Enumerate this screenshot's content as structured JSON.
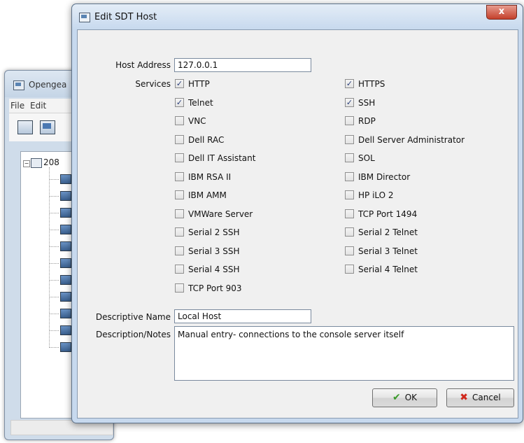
{
  "background_window": {
    "title": "Opengea",
    "menu": [
      "File",
      "Edit"
    ],
    "tree_root_label": "208",
    "tree_root_toggle": "−"
  },
  "dialog": {
    "title": "Edit SDT Host",
    "close_symbol": "x",
    "host_address_label": "Host Address",
    "host_address_value": "127.0.0.1",
    "services_label": "Services",
    "services_left": [
      {
        "label": "HTTP",
        "checked": true
      },
      {
        "label": "Telnet",
        "checked": true
      },
      {
        "label": "VNC",
        "checked": false
      },
      {
        "label": "Dell RAC",
        "checked": false
      },
      {
        "label": "Dell IT Assistant",
        "checked": false
      },
      {
        "label": "IBM RSA II",
        "checked": false
      },
      {
        "label": "IBM AMM",
        "checked": false
      },
      {
        "label": "VMWare Server",
        "checked": false
      },
      {
        "label": "Serial 2 SSH",
        "checked": false
      },
      {
        "label": "Serial 3 SSH",
        "checked": false
      },
      {
        "label": "Serial 4 SSH",
        "checked": false
      },
      {
        "label": "TCP Port 903",
        "checked": false
      }
    ],
    "services_right": [
      {
        "label": "HTTPS",
        "checked": true
      },
      {
        "label": "SSH",
        "checked": true
      },
      {
        "label": "RDP",
        "checked": false
      },
      {
        "label": "Dell Server Administrator",
        "checked": false
      },
      {
        "label": "SOL",
        "checked": false
      },
      {
        "label": "IBM Director",
        "checked": false
      },
      {
        "label": "HP iLO 2",
        "checked": false
      },
      {
        "label": "TCP Port 1494",
        "checked": false
      },
      {
        "label": "Serial 2 Telnet",
        "checked": false
      },
      {
        "label": "Serial 3 Telnet",
        "checked": false
      },
      {
        "label": "Serial 4 Telnet",
        "checked": false
      }
    ],
    "descriptive_name_label": "Descriptive Name",
    "descriptive_name_value": "Local Host",
    "description_label": "Description/Notes",
    "description_value": "Manual entry- connections to the console server itself",
    "ok_label": "OK",
    "cancel_label": "Cancel",
    "ok_icon": "checkmark-icon",
    "cancel_icon": "red-x-icon",
    "colors": {
      "ok_icon": "#3a9a2a",
      "cancel_icon": "#d0281c",
      "checkbox_mark": "#2a3f7a"
    }
  }
}
